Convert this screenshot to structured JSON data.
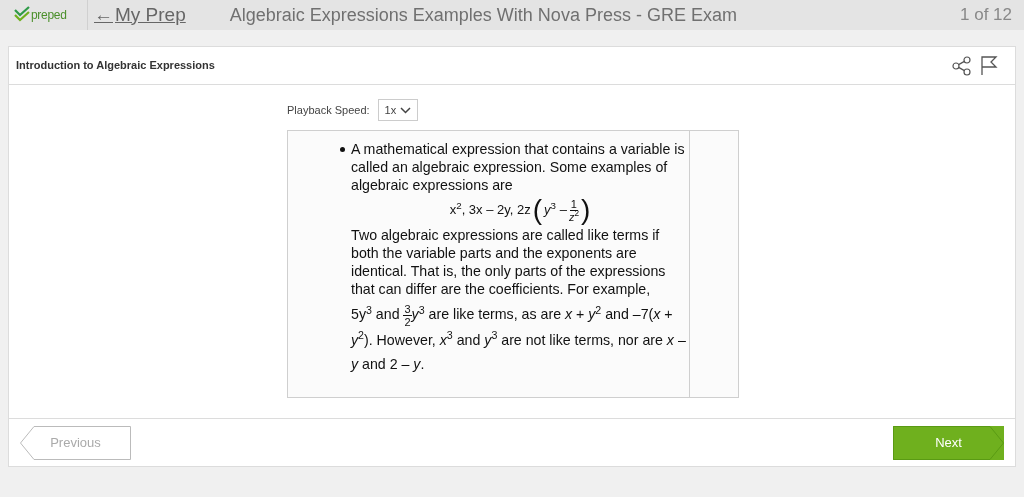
{
  "top_bar": {
    "logo": "preped",
    "back_arrow": "←",
    "back_link": "My Prep",
    "title": "Algebraic Expressions Examples With Nova Press - GRE Exam",
    "page_counter": "1 of 12"
  },
  "lesson": {
    "title": "Introduction to Algebraic Expressions",
    "playback": {
      "label": "Playback Speed:",
      "value": "1x"
    },
    "slide": {
      "bullet": "A mathematical expression that contains a variable is called an algebraic expression.  Some examples of algebraic expressions are",
      "formula": {
        "lead": "x$^{2}$, 3x – 2y, 2z",
        "open_paren": "(",
        "close_paren": ")",
        "inner": "*y*$^{3}$ –",
        "numerator": "1",
        "denominator": "*z*$^{2}$"
      },
      "paragraph": "Two algebraic expressions are called like terms if both the variable parts and the exponents are identical.  That is, the only parts of the expressions that can differ are the coefficients.  For example,",
      "example_before": "5y$^{3}$ and",
      "example_fraction": {
        "numerator": "3",
        "denominator": "2"
      },
      "example_after": "*y*$^{3}$ are like terms, as are *x* + *y*$^{2}$ and –7(*x* + *y*$^{2}$).  However, *x*$^{3}$ and *y*$^{3}$ are not like terms, nor are *x* – *y* and 2 – *y*."
    }
  },
  "nav": {
    "previous": {
      "label": "Previous",
      "disabled": true
    },
    "next": {
      "label": "Next",
      "disabled": false
    }
  }
}
